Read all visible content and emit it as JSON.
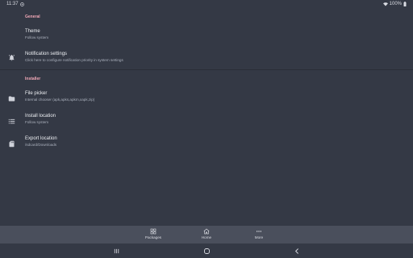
{
  "status": {
    "time": "11:37",
    "battery": "100%"
  },
  "sections": [
    {
      "title": "General"
    },
    {
      "title": "Installer"
    }
  ],
  "prefs": [
    {
      "title": "Theme",
      "summary": "Follow system"
    },
    {
      "title": "Notification settings",
      "summary": "Click here to configure notification priority in system settings",
      "icon": "alarm-bell-icon"
    },
    {
      "title": "File picker",
      "summary": "Internal chooser (apk,apks,apkm,xapk,zip)",
      "icon": "folder-icon"
    },
    {
      "title": "Install location",
      "summary": "Follow system",
      "icon": "list-icon"
    },
    {
      "title": "Export location",
      "summary": "/sdcard/Downloads",
      "icon": "sd-card-icon"
    }
  ],
  "nav": {
    "packages": "Packages",
    "home": "Home",
    "more": "More"
  },
  "colors": {
    "accent": "#f0a7b6",
    "background": "#343945",
    "bottom_nav": "#4a4f5c"
  }
}
